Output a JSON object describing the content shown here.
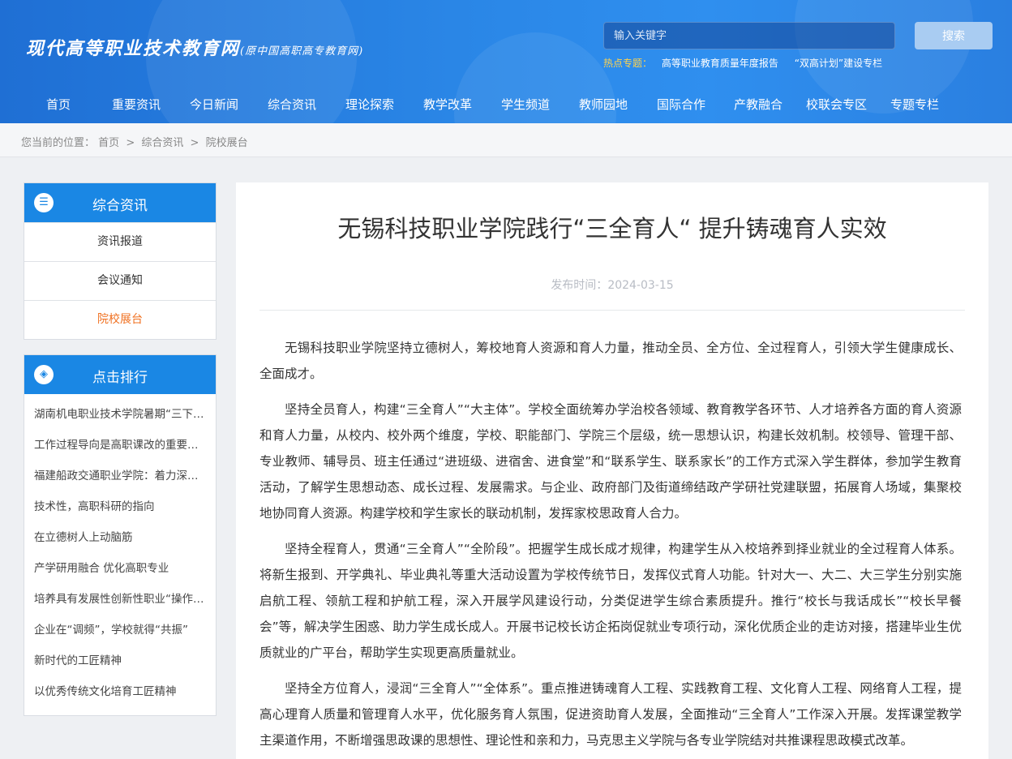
{
  "header": {
    "logo_main": "现代高等职业技术教育网",
    "logo_sub": "(原中国高职高专教育网)",
    "search_placeholder": "输入关键字",
    "search_button": "搜索",
    "hot_label": "热点专题：",
    "hot_links": [
      "高等职业教育质量年度报告",
      "“双高计划”建设专栏"
    ]
  },
  "nav": [
    "首页",
    "重要资讯",
    "今日新闻",
    "综合资讯",
    "理论探索",
    "教学改革",
    "学生频道",
    "教师园地",
    "国际合作",
    "产教融合",
    "校联会专区",
    "专题专栏"
  ],
  "breadcrumb": {
    "prefix": "您当前的位置：",
    "items": [
      "首页",
      "综合资讯",
      "院校展台"
    ],
    "sep": ">"
  },
  "sidebar": {
    "section_title": "综合资讯",
    "section_items": [
      "资讯报道",
      "会议通知",
      "院校展台"
    ],
    "active_index": 2,
    "rank_title": "点击排行",
    "rank_items": [
      "湖南机电职业技术学院暑期“三下乡”",
      "工作过程导向是高职课改的重要方向",
      "福建船政交通职业学院：着力深化产教融合",
      "技术性，高职科研的指向",
      "在立德树人上动脑筋",
      "产学研用融合 优化高职专业",
      "培养具有发展性创新性职业“操作者”",
      "企业在“调频”，学校就得“共振”",
      "新时代的工匠精神",
      "以优秀传统文化培育工匠精神"
    ]
  },
  "article": {
    "title": "无锡科技职业学院践行“三全育人“ 提升铸魂育人实效",
    "date_label": "发布时间：",
    "date": "2024-03-15",
    "paragraphs": [
      "无锡科技职业学院坚持立德树人，筹校地育人资源和育人力量，推动全员、全方位、全过程育人，引领大学生健康成长、全面成才。",
      "坚持全员育人，构建“三全育人”“大主体”。学校全面统筹办学治校各领域、教育教学各环节、人才培养各方面的育人资源和育人力量，从校内、校外两个维度，学校、职能部门、学院三个层级，统一思想认识，构建长效机制。校领导、管理干部、专业教师、辅导员、班主任通过“进班级、进宿舍、进食堂”和“联系学生、联系家长”的工作方式深入学生群体，参加学生教育活动，了解学生思想动态、成长过程、发展需求。与企业、政府部门及街道缔结政产学研社党建联盟，拓展育人场域，集聚校地协同育人资源。构建学校和学生家长的联动机制，发挥家校思政育人合力。",
      "坚持全程育人，贯通“三全育人”“全阶段”。把握学生成长成才规律，构建学生从入校培养到择业就业的全过程育人体系。将新生报到、开学典礼、毕业典礼等重大活动设置为学校传统节日，发挥仪式育人功能。针对大一、大二、大三学生分别实施启航工程、领航工程和护航工程，深入开展学风建设行动，分类促进学生综合素质提升。推行“校长与我话成长”“校长早餐会”等，解决学生困惑、助力学生成长成人。开展书记校长访企拓岗促就业专项行动，深化优质企业的走访对接，搭建毕业生优质就业的广平台，帮助学生实现更高质量就业。",
      "坚持全方位育人，浸润“三全育人”“全体系”。重点推进铸魂育人工程、实践教育工程、文化育人工程、网络育人工程，提高心理育人质量和管理育人水平，优化服务育人氛围，促进资助育人发展，全面推动“三全育人”工作深入开展。发挥课堂教学主渠道作用，不断增强思政课的思想性、理论性和亲和力，马克思主义学院与各专业学院结对共推课程思政模式改革。"
    ]
  }
}
